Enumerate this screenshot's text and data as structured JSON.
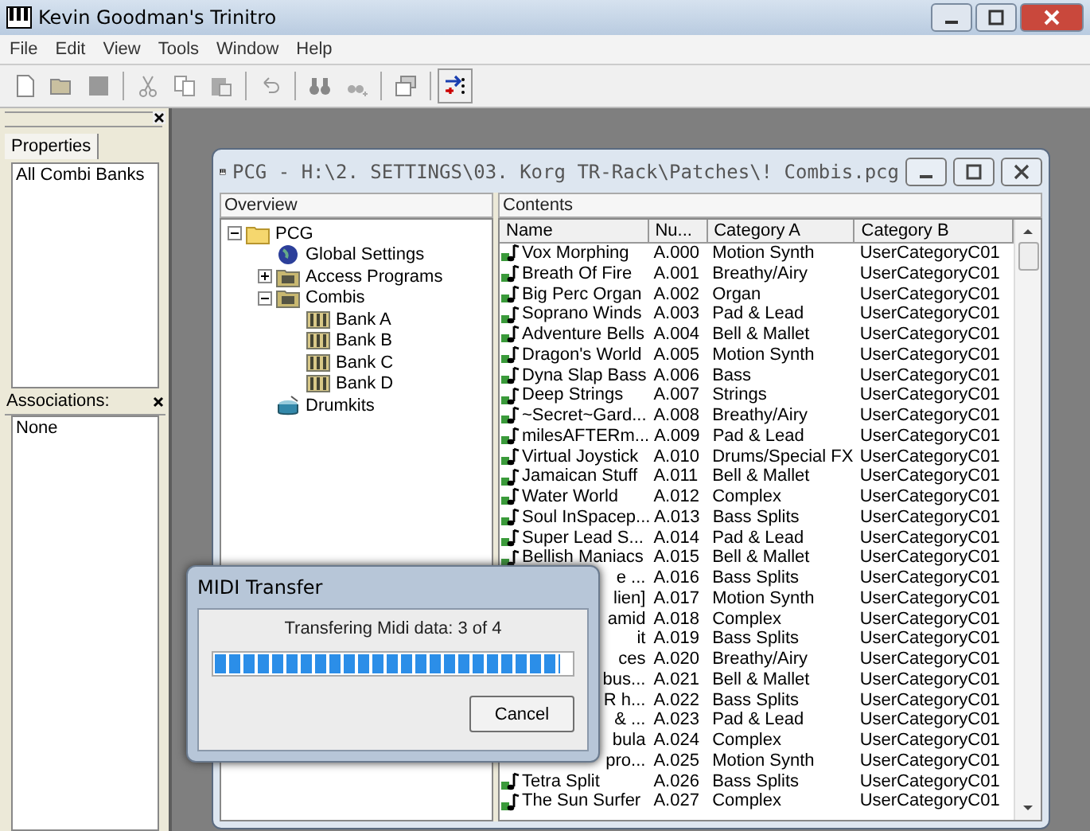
{
  "app_window": {
    "title": "Kevin Goodman's Trinitro"
  },
  "menu": [
    "File",
    "Edit",
    "View",
    "Tools",
    "Window",
    "Help"
  ],
  "toolbar": [
    {
      "kind": "new"
    },
    {
      "kind": "open"
    },
    {
      "kind": "save"
    },
    {
      "kind": "sep"
    },
    {
      "kind": "cut"
    },
    {
      "kind": "copy"
    },
    {
      "kind": "paste"
    },
    {
      "kind": "sep"
    },
    {
      "kind": "undo"
    },
    {
      "kind": "sep"
    },
    {
      "kind": "find"
    },
    {
      "kind": "find-next"
    },
    {
      "kind": "sep"
    },
    {
      "kind": "window"
    },
    {
      "kind": "sep"
    },
    {
      "kind": "transfer"
    }
  ],
  "properties_panel": {
    "tab": {
      "label": "Properties",
      "selected": true
    },
    "items": [
      "All Combi Banks"
    ]
  },
  "associations_panel": {
    "title": "Associations:",
    "items": [
      "None"
    ]
  },
  "pcg_window": {
    "title": "PCG - H:\\2. SETTINGS\\03. Korg TR-Rack\\Patches\\! Combis.pcg",
    "overview": {
      "title": "Overview",
      "tree": [
        {
          "label": "PCG",
          "kind": "folder",
          "expanded": true,
          "children": [
            {
              "label": "Global Settings",
              "kind": "globe"
            },
            {
              "label": "Access Programs",
              "kind": "bank",
              "expanded": false
            },
            {
              "label": "Combis",
              "kind": "bank",
              "expanded": true,
              "children": [
                {
                  "label": "Bank A",
                  "kind": "combi"
                },
                {
                  "label": "Bank B",
                  "kind": "combi"
                },
                {
                  "label": "Bank C",
                  "kind": "combi"
                },
                {
                  "label": "Bank D",
                  "kind": "combi"
                }
              ]
            },
            {
              "label": "Drumkits",
              "kind": "drum"
            }
          ]
        }
      ]
    },
    "contents": {
      "title": "Contents",
      "columns": [
        "Name",
        "Nu...",
        "Category A",
        "Category B"
      ],
      "rows": [
        {
          "name": "Vox Morphing",
          "number": "A.000",
          "category_a": "Motion Synth",
          "category_b": "UserCategoryC01"
        },
        {
          "name": "Breath Of Fire",
          "number": "A.001",
          "category_a": "Breathy/Airy",
          "category_b": "UserCategoryC01"
        },
        {
          "name": "Big Perc Organ",
          "number": "A.002",
          "category_a": "Organ",
          "category_b": "UserCategoryC01"
        },
        {
          "name": "Soprano Winds",
          "number": "A.003",
          "category_a": "Pad & Lead",
          "category_b": "UserCategoryC01"
        },
        {
          "name": "Adventure Bells",
          "number": "A.004",
          "category_a": "Bell & Mallet",
          "category_b": "UserCategoryC01"
        },
        {
          "name": "Dragon's World",
          "number": "A.005",
          "category_a": "Motion Synth",
          "category_b": "UserCategoryC01"
        },
        {
          "name": "Dyna Slap Bass",
          "number": "A.006",
          "category_a": "Bass",
          "category_b": "UserCategoryC01"
        },
        {
          "name": "Deep Strings",
          "number": "A.007",
          "category_a": "Strings",
          "category_b": "UserCategoryC01"
        },
        {
          "name": "~Secret~Gard...",
          "number": "A.008",
          "category_a": "Breathy/Airy",
          "category_b": "UserCategoryC01"
        },
        {
          "name": "milesAFTERm...",
          "number": "A.009",
          "category_a": "Pad & Lead",
          "category_b": "UserCategoryC01"
        },
        {
          "name": "Virtual Joystick",
          "number": "A.010",
          "category_a": "Drums/Special FX",
          "category_b": "UserCategoryC01"
        },
        {
          "name": "Jamaican Stuff",
          "number": "A.011",
          "category_a": "Bell & Mallet",
          "category_b": "UserCategoryC01"
        },
        {
          "name": "Water World",
          "number": "A.012",
          "category_a": "Complex",
          "category_b": "UserCategoryC01"
        },
        {
          "name": "Soul InSpacep...",
          "number": "A.013",
          "category_a": "Bass Splits",
          "category_b": "UserCategoryC01"
        },
        {
          "name": "Super Lead S...",
          "number": "A.014",
          "category_a": "Pad & Lead",
          "category_b": "UserCategoryC01"
        },
        {
          "name": "Bellish Maniacs",
          "number": "A.015",
          "category_a": "Bell & Mallet",
          "category_b": "UserCategoryC01"
        },
        {
          "name_fragment": "e ...",
          "number": "A.016",
          "category_a": "Bass Splits",
          "category_b": "UserCategoryC01"
        },
        {
          "name_fragment": "lien]",
          "number": "A.017",
          "category_a": "Motion Synth",
          "category_b": "UserCategoryC01"
        },
        {
          "name_fragment": "amid",
          "number": "A.018",
          "category_a": "Complex",
          "category_b": "UserCategoryC01"
        },
        {
          "name_fragment": "it",
          "number": "A.019",
          "category_a": "Bass Splits",
          "category_b": "UserCategoryC01"
        },
        {
          "name_fragment": "ces",
          "number": "A.020",
          "category_a": "Breathy/Airy",
          "category_b": "UserCategoryC01"
        },
        {
          "name_fragment": "bus...",
          "number": "A.021",
          "category_a": "Bell & Mallet",
          "category_b": "UserCategoryC01"
        },
        {
          "name_fragment": "R h...",
          "number": "A.022",
          "category_a": "Bass Splits",
          "category_b": "UserCategoryC01"
        },
        {
          "name_fragment": "& ...",
          "number": "A.023",
          "category_a": "Pad & Lead",
          "category_b": "UserCategoryC01"
        },
        {
          "name_fragment": "bula",
          "number": "A.024",
          "category_a": "Complex",
          "category_b": "UserCategoryC01"
        },
        {
          "name_fragment": "pro...",
          "number": "A.025",
          "category_a": "Motion Synth",
          "category_b": "UserCategoryC01"
        },
        {
          "name": "Tetra Split",
          "number": "A.026",
          "category_a": "Bass Splits",
          "category_b": "UserCategoryC01"
        },
        {
          "name": "The Sun Surfer",
          "number": "A.027",
          "category_a": "Complex",
          "category_b": "UserCategoryC01"
        }
      ]
    }
  },
  "midi_dialog": {
    "title": "MIDI Transfer",
    "message": "Transfering Midi data: 3 of 4",
    "level": 0.97,
    "button": "Cancel"
  }
}
